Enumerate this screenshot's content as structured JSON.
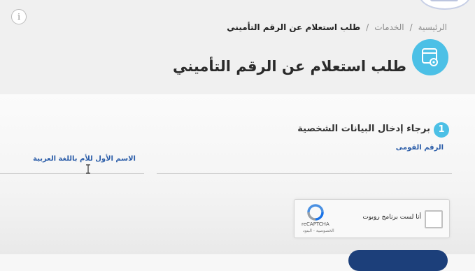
{
  "breadcrumb": {
    "home": "الرئيسية",
    "services": "الخدمات",
    "current": "طلب استعلام عن الرقم التأميني",
    "separator": "/"
  },
  "page": {
    "title": "طلب استعلام عن الرقم التأميني"
  },
  "form": {
    "step_number": "1",
    "step_title": "برجاء إدخال البيانات الشخصية",
    "national_id_label": "الرقم القومى",
    "national_id_value": "",
    "mother_name_label": "الاسم الأول للأم باللغة العربية",
    "mother_name_value": ""
  },
  "recaptcha": {
    "label": "أنا لست برنامج روبوت",
    "brand": "reCAPTCHA",
    "terms": "الخصوصية - البنود"
  },
  "colors": {
    "accent": "#4cc0e6",
    "label_blue": "#2a5ca8",
    "button_navy": "#1c3f7a"
  }
}
